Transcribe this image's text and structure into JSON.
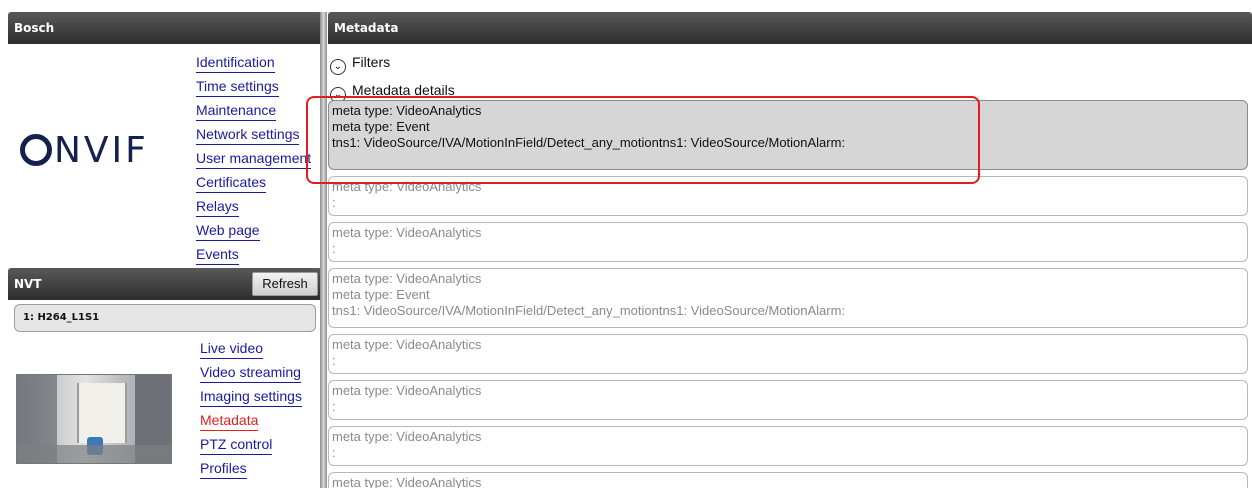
{
  "left_panel": {
    "brand_header": "Bosch",
    "logo_text": "nvif",
    "nav_top": [
      "Identification",
      "Time settings",
      "Maintenance",
      "Network settings",
      "User management",
      "Certificates",
      "Relays",
      "Web page",
      "Events"
    ],
    "nvt_header": "NVT",
    "refresh_label": "Refresh",
    "stream_value": "1: H264_L1S1",
    "nav_bottom": [
      "Live video",
      "Video streaming",
      "Imaging settings",
      "Metadata",
      "PTZ control",
      "Profiles"
    ],
    "active_item": "Metadata"
  },
  "right_panel": {
    "header": "Metadata",
    "filters_label": "Filters",
    "details_label": "Metadata details",
    "entries": [
      {
        "lines": [
          "meta type: VideoAnalytics",
          "meta type: Event",
          "tns1: VideoSource/IVA/MotionInField/Detect_any_motiontns1: VideoSource/MotionAlarm:"
        ],
        "highlighted": true
      },
      {
        "lines": [
          "meta type: VideoAnalytics",
          ":"
        ],
        "highlighted": false
      },
      {
        "lines": [
          "meta type: VideoAnalytics",
          ":"
        ],
        "highlighted": false
      },
      {
        "lines": [
          "meta type: VideoAnalytics",
          "meta type: Event",
          "tns1: VideoSource/IVA/MotionInField/Detect_any_motiontns1: VideoSource/MotionAlarm:"
        ],
        "highlighted": false
      },
      {
        "lines": [
          "meta type: VideoAnalytics",
          ":"
        ],
        "highlighted": false
      },
      {
        "lines": [
          "meta type: VideoAnalytics",
          ":"
        ],
        "highlighted": false
      },
      {
        "lines": [
          "meta type: VideoAnalytics",
          ":"
        ],
        "highlighted": false
      },
      {
        "lines": [
          "meta type: VideoAnalytics",
          ":"
        ],
        "highlighted": false
      }
    ]
  },
  "colors": {
    "link": "#1a1aa0",
    "active_link": "#e02020",
    "highlight_outline": "#e01e1e",
    "header_bg": "#3a3a3a"
  }
}
